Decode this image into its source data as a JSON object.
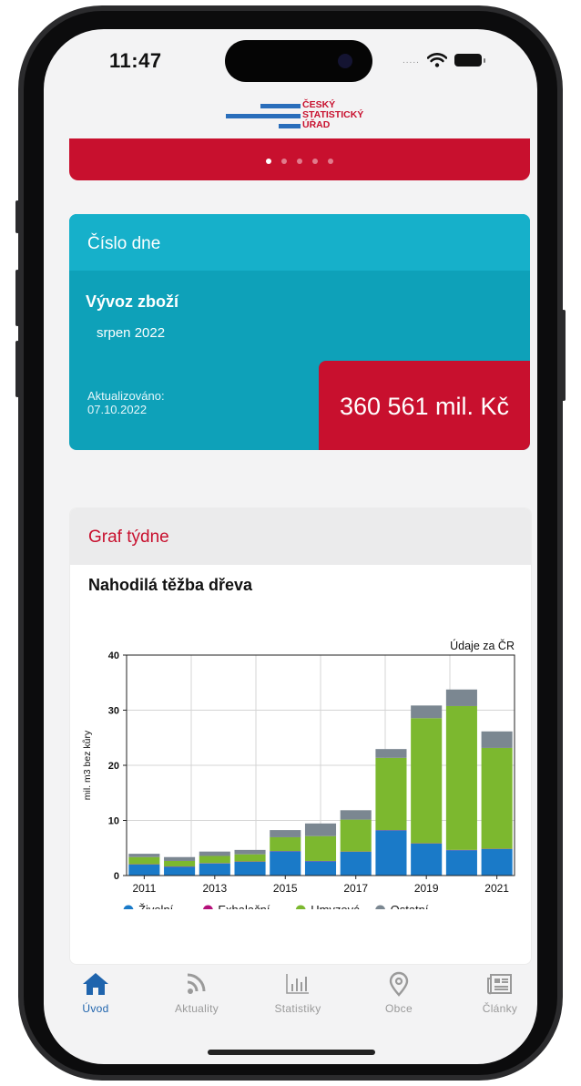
{
  "status_bar": {
    "time": "11:47",
    "signal": "....."
  },
  "logo": {
    "line1": "ČESKÝ",
    "line2": "STATISTICKÝ",
    "line3": "ÚŘAD"
  },
  "carousel": {
    "pages": 5,
    "active_page": 1,
    "color": "#c8102e"
  },
  "number_of_day": {
    "header": "Číslo dne",
    "title": "Vývoz zboží",
    "period": "srpen 2022",
    "updated_label": "Aktualizováno:",
    "updated_date": "07.10.2022",
    "value": "360 561 mil. Kč"
  },
  "graph_of_week": {
    "header": "Graf týdne",
    "title": "Nahodilá těžba dřeva"
  },
  "chart_data": {
    "type": "bar",
    "stacked": true,
    "annotation": "Údaje za ČR",
    "ylabel": "mil. m3 bez kůry",
    "xlabel": "",
    "ylim": [
      0,
      40
    ],
    "yticks": [
      0,
      10,
      20,
      30,
      40
    ],
    "categories": [
      "2011",
      "2012",
      "2013",
      "2014",
      "2015",
      "2016",
      "2017",
      "2018",
      "2019",
      "2020",
      "2021"
    ],
    "xtick_labels": [
      "2011",
      "2013",
      "2015",
      "2017",
      "2019",
      "2021"
    ],
    "grid": true,
    "legend_position": "bottom",
    "series": [
      {
        "name": "Živelní",
        "color": "#1a7ac8",
        "values": [
          2.0,
          1.6,
          2.2,
          2.5,
          4.4,
          2.6,
          4.3,
          8.2,
          5.8,
          4.6,
          4.8
        ]
      },
      {
        "name": "Exhalační",
        "color": "#b5107a",
        "values": [
          0.05,
          0.05,
          0.05,
          0.05,
          0.05,
          0.05,
          0.05,
          0.05,
          0.05,
          0.05,
          0.05
        ]
      },
      {
        "name": "Hmyzová",
        "color": "#7cb82f",
        "values": [
          1.3,
          1.0,
          1.3,
          1.3,
          2.5,
          4.5,
          5.8,
          13.1,
          22.7,
          26.1,
          18.3
        ]
      },
      {
        "name": "Ostatní",
        "color": "#7b8791",
        "values": [
          0.6,
          0.7,
          0.8,
          0.8,
          1.3,
          2.3,
          1.7,
          1.6,
          2.3,
          3.0,
          3.0
        ]
      }
    ]
  },
  "nav": {
    "items": [
      {
        "label": "Úvod",
        "icon": "home-icon",
        "active": true
      },
      {
        "label": "Aktuality",
        "icon": "rss-icon",
        "active": false
      },
      {
        "label": "Statistiky",
        "icon": "bar-chart-icon",
        "active": false
      },
      {
        "label": "Obce",
        "icon": "location-pin-icon",
        "active": false
      },
      {
        "label": "Články",
        "icon": "newspaper-icon",
        "active": false
      }
    ]
  }
}
